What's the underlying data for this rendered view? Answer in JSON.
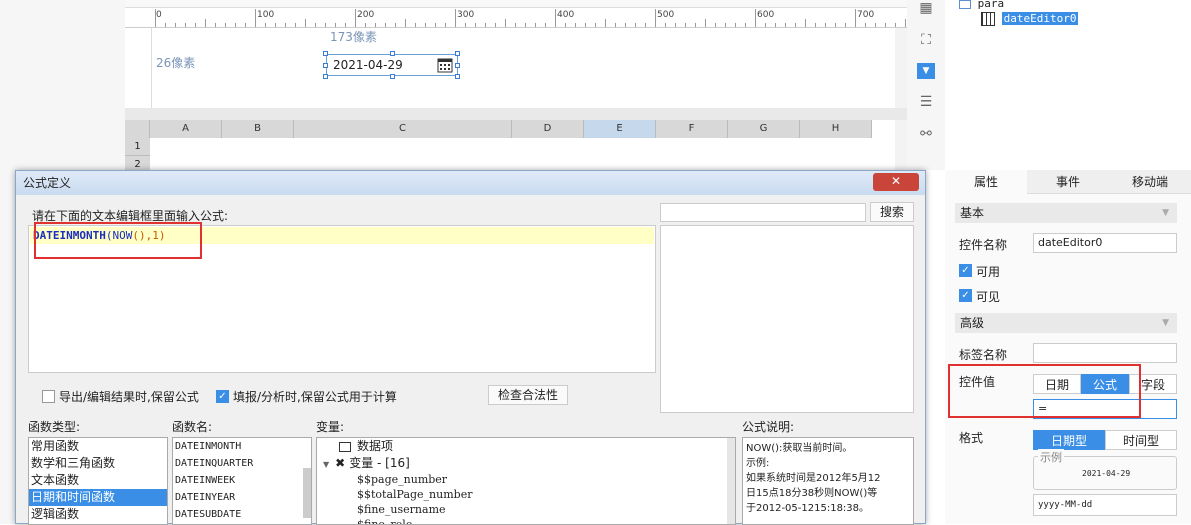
{
  "canvas": {
    "ruler_labels": [
      "0",
      "100",
      "200",
      "300",
      "400",
      "500",
      "600",
      "700"
    ],
    "height_hint": "26像素",
    "width_hint": "173像素",
    "date_value": "2021-04-29",
    "grid_columns": [
      "A",
      "B",
      "C",
      "D",
      "E",
      "F",
      "G",
      "H"
    ],
    "grid_rows": [
      "1",
      "2"
    ]
  },
  "tree": {
    "root": "para",
    "child": "dateEditor0"
  },
  "properties": {
    "tabs": [
      "属性",
      "事件",
      "移动端"
    ],
    "basic_section": "基本",
    "control_name_label": "控件名称",
    "control_name_value": "dateEditor0",
    "enabled_label": "可用",
    "visible_label": "可见",
    "advanced_section": "高级",
    "tag_name_label": "标签名称",
    "control_value_label": "控件值",
    "value_modes": [
      "日期",
      "公式",
      "字段"
    ],
    "formula_value": "=",
    "format_label": "格式",
    "format_modes": [
      "日期型",
      "时间型"
    ],
    "example_label": "示例",
    "example_value": "2021-04-29",
    "format_pattern": "yyyy-MM-dd"
  },
  "dialog": {
    "title": "公式定义",
    "close_label": "✕",
    "prompt": "请在下面的文本编辑框里面输入公式:",
    "formula_fn": "DATEINMONTH",
    "formula_open": "(",
    "formula_now": "NOW",
    "formula_args": "(),",
    "formula_num": "1",
    "formula_close": ")",
    "search_button": "搜索",
    "keep_on_export": "导出/编辑结果时,保留公式",
    "keep_on_fill": "填报/分析时,保留公式用于计算",
    "check_button": "检查合法性",
    "func_type_header": "函数类型:",
    "func_name_header": "函数名:",
    "variable_header": "变量:",
    "description_header": "公式说明:",
    "func_types": [
      "常用函数",
      "数学和三角函数",
      "文本函数",
      "日期和时间函数",
      "逻辑函数"
    ],
    "selected_func_type": 3,
    "func_names": [
      "DATEINMONTH",
      "DATEINQUARTER",
      "DATEINWEEK",
      "DATEINYEAR",
      "DATESUBDATE"
    ],
    "data_item": "数据项",
    "variable_group": "变量 - [16]",
    "variables": [
      "$$page_number",
      "$$totalPage_number",
      "$fine_username",
      "$fine_role"
    ],
    "description_lines": [
      "NOW():获取当前时间。",
      "示例:",
      "如果系统时间是2012年5月12",
      "日15点18分38秒则NOW()等",
      "于2012-05-1215:18:38。"
    ]
  },
  "colors": {
    "accent": "#3a8ee6",
    "highlight_box": "#e03030",
    "editor_line": "#ffffc6"
  }
}
